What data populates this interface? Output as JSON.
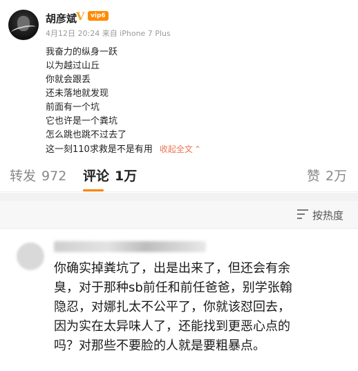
{
  "post": {
    "username": "胡彦斌",
    "verified_badge": "V",
    "level_badge": "vip6",
    "meta": "4月12日 20:24 来自 iPhone 7 Plus",
    "lines": [
      "我奋力的纵身一跃",
      "以为越过山丘",
      "你就会跟丢",
      "还未落地就发现",
      "前面有一个坑",
      "它也许是一个粪坑",
      "怎么跳也跳不过去了",
      "这一刻110求救是不是有用"
    ],
    "collapse_label": "收起全文",
    "collapse_icon": "chevron-up-icon"
  },
  "tabs": [
    {
      "label": "转发",
      "count": "972"
    },
    {
      "label": "评论",
      "count": "1万"
    },
    {
      "label": "赞",
      "count": "2万"
    }
  ],
  "sort": {
    "label": "按热度",
    "icon": "sort-icon"
  },
  "comment": {
    "lines": [
      "你确实掉粪坑了，出是出来了，但还会有余",
      "臭，对于那种sb前任和前任爸爸，别学张翰",
      "隐忍，对娜扎太不公平了，你就该怼回去，",
      "因为实在太异味人了，还能找到更恶心点的",
      "吗？对那些不要脸的人就是要粗暴点。"
    ]
  },
  "colors": {
    "accent": "#ff8200",
    "link": "#eb7350",
    "verified": "#f5a623"
  }
}
